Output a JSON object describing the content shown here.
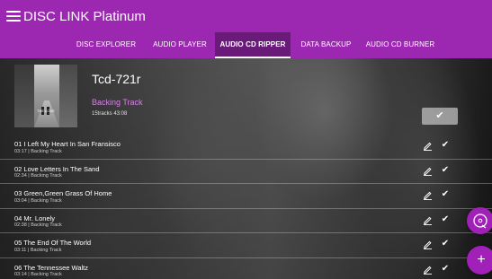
{
  "app": {
    "title": "DISC LINK Platinum"
  },
  "tabs": [
    {
      "label": "DISC EXPLORER"
    },
    {
      "label": "AUDIO PLAYER"
    },
    {
      "label": "AUDIO CD RIPPER",
      "active": true
    },
    {
      "label": "DATA BACKUP"
    },
    {
      "label": "AUDIO CD BURNER"
    }
  ],
  "album": {
    "title": "Tcd-721r",
    "subtitle": "Backing Track",
    "meta": "15tracks 43:08",
    "cover_caption": "THE LOVE"
  },
  "select_all_icon": "check",
  "tracks": [
    {
      "title": "01  I Left My Heart In San Fransisco",
      "meta": "03:17 | Backing Track"
    },
    {
      "title": "02  Love Letters In The Sand",
      "meta": "02:34 | Backing Track"
    },
    {
      "title": "03  Green,Green Grass Of Home",
      "meta": "03:04 | Backing Track"
    },
    {
      "title": "04  Mr. Lonely",
      "meta": "02:38 | Backing Track"
    },
    {
      "title": "05  The End Of The World",
      "meta": "03:11 | Backing Track"
    },
    {
      "title": "06  The Tennessee Waltz",
      "meta": "03:14 | Backing Track"
    }
  ],
  "icons": {
    "menu": "menu-icon",
    "edit": "pencil-icon",
    "check": "check-icon",
    "disc": "disc-icon",
    "add": "plus-icon"
  },
  "colors": {
    "primary": "#9c27b0",
    "tab_active": "#6a1b7a",
    "accent_text": "#d580e8",
    "fab": "#a020b8"
  }
}
